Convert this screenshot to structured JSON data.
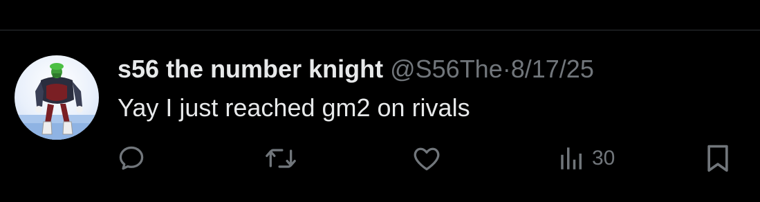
{
  "post": {
    "display_name": "s56 the number knight",
    "handle": "@S56The",
    "separator": "·",
    "date": "8/17/25",
    "text": "Yay I just reached gm2 on rivals",
    "avatar_icon": "character-avatar",
    "actions": {
      "reply_icon": "reply-icon",
      "repost_icon": "repost-icon",
      "like_icon": "heart-icon",
      "views_icon": "views-chart-icon",
      "views_count": "30",
      "bookmark_icon": "bookmark-icon"
    }
  },
  "colors": {
    "background": "#000000",
    "primary_text": "#e7e9ea",
    "secondary_text": "#71767b",
    "divider": "#2f3336"
  }
}
